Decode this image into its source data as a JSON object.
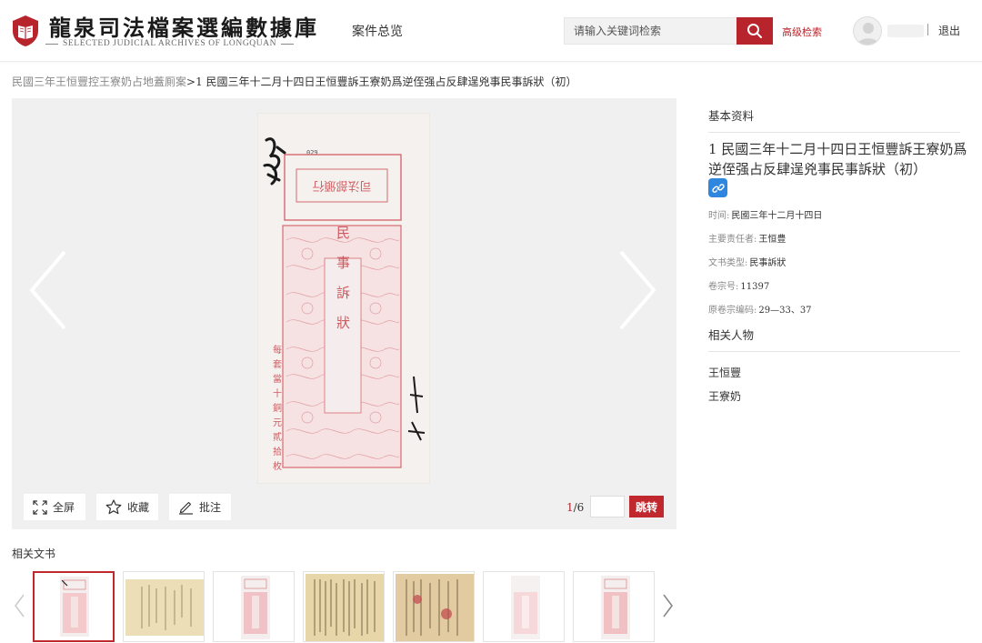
{
  "header": {
    "logo_title": "龍泉司法檔案選編數據庫",
    "logo_subtitle": "SELECTED JUDICIAL ARCHIVES OF LONGQUAN",
    "nav_overview": "案件总览",
    "search_placeholder": "请输入关键词检索",
    "advanced_search": "高级检索",
    "logout": "退出"
  },
  "breadcrumb": {
    "parent": "民國三年王恒豐控王寮奶占地蓋厠案",
    "separator": ">",
    "current": "1 民國三年十二月十四日王恒豐訴王寮奶爲逆侄强占反肆逞兇事民事訴狀（初）"
  },
  "viewer": {
    "fullscreen_label": "全屏",
    "favorite_label": "收藏",
    "annotate_label": "批注",
    "page_current": "1",
    "page_total": "/6",
    "page_input_value": "",
    "jump_label": "跳转",
    "doc_stamp_number": "029",
    "doc_box_text": "司法部頒行",
    "doc_center_text": "民事訴狀",
    "doc_left_text": "每套當十銅元貳拾枚"
  },
  "info": {
    "basic_heading": "基本资料",
    "title": "1 民國三年十二月十四日王恒豐訴王寮奶爲逆侄强占反肆逞兇事民事訴狀（初）",
    "fields": [
      {
        "label": "时间:",
        "value": "民國三年十二月十四日"
      },
      {
        "label": "主要责任者:",
        "value": "王恒豊"
      },
      {
        "label": "文书类型:",
        "value": "民事訴狀"
      },
      {
        "label": "卷宗号:",
        "value": "11397"
      },
      {
        "label": "原卷宗编码:",
        "value": "29—33、37"
      }
    ],
    "people_heading": "相关人物",
    "people": [
      "王恒豐",
      "王寮奶"
    ]
  },
  "related": {
    "title": "相关文书",
    "thumbnails": [
      "red-form",
      "handwritten-beige",
      "red-form",
      "handwritten-dense",
      "handwritten-red-stamps",
      "red-form-faded",
      "red-form"
    ]
  },
  "colors": {
    "accent": "#b8242b",
    "link_blue": "#2e86de",
    "viewer_bg": "#f0f0f0"
  }
}
